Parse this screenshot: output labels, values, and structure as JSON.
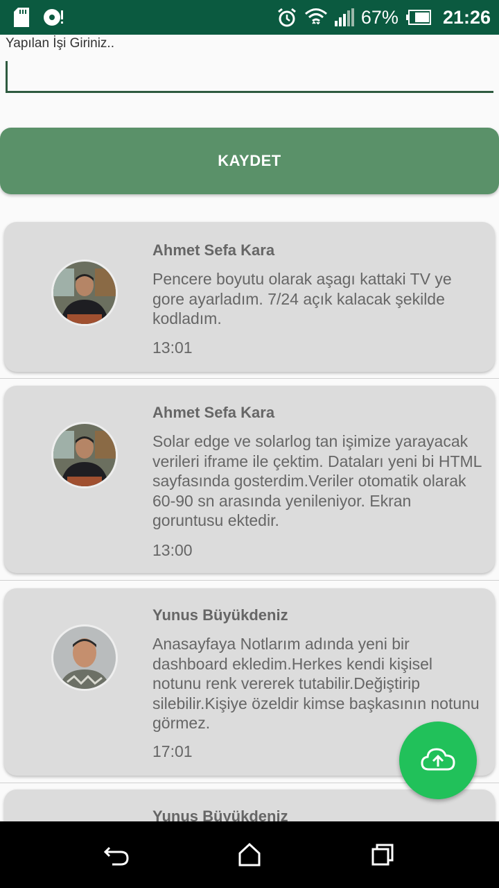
{
  "status_bar": {
    "battery": "67%",
    "time": "21:26"
  },
  "form": {
    "label": "Yapılan İşi Giriniz..",
    "input_value": "",
    "save_label": "KAYDET"
  },
  "entries": [
    {
      "name": "Ahmet Sefa Kara",
      "message": "Pencere boyutu olarak aşagı kattaki TV ye gore ayarladım. 7/24 açık kalacak şekilde kodladım.",
      "time": "13:01"
    },
    {
      "name": "Ahmet Sefa Kara",
      "message": "Solar edge ve solarlog tan işimize yarayacak verileri iframe ile çektim. Dataları yeni bi HTML sayfasında gosterdim.Veriler otomatik olarak 60-90 sn arasında yenileniyor. Ekran goruntusu ektedir.",
      "time": "13:00"
    },
    {
      "name": "Yunus Büyükdeniz",
      "message": "Anasayfaya Notlarım adında yeni bir dashboard ekledim.Herkes kendi kişisel notunu renk vererek tutabilir.Değiştirip silebilir.Kişiye özeldir kimse başkasının notunu görmez.",
      "time": "17:01"
    },
    {
      "name": "Yunus Büyükdeniz"
    }
  ],
  "fab_icon": "cloud-upload-icon",
  "colors": {
    "status_bar": "#0b5a40",
    "save_button": "#5a9169",
    "fab": "#21c15a",
    "card": "#dcdcdc"
  }
}
